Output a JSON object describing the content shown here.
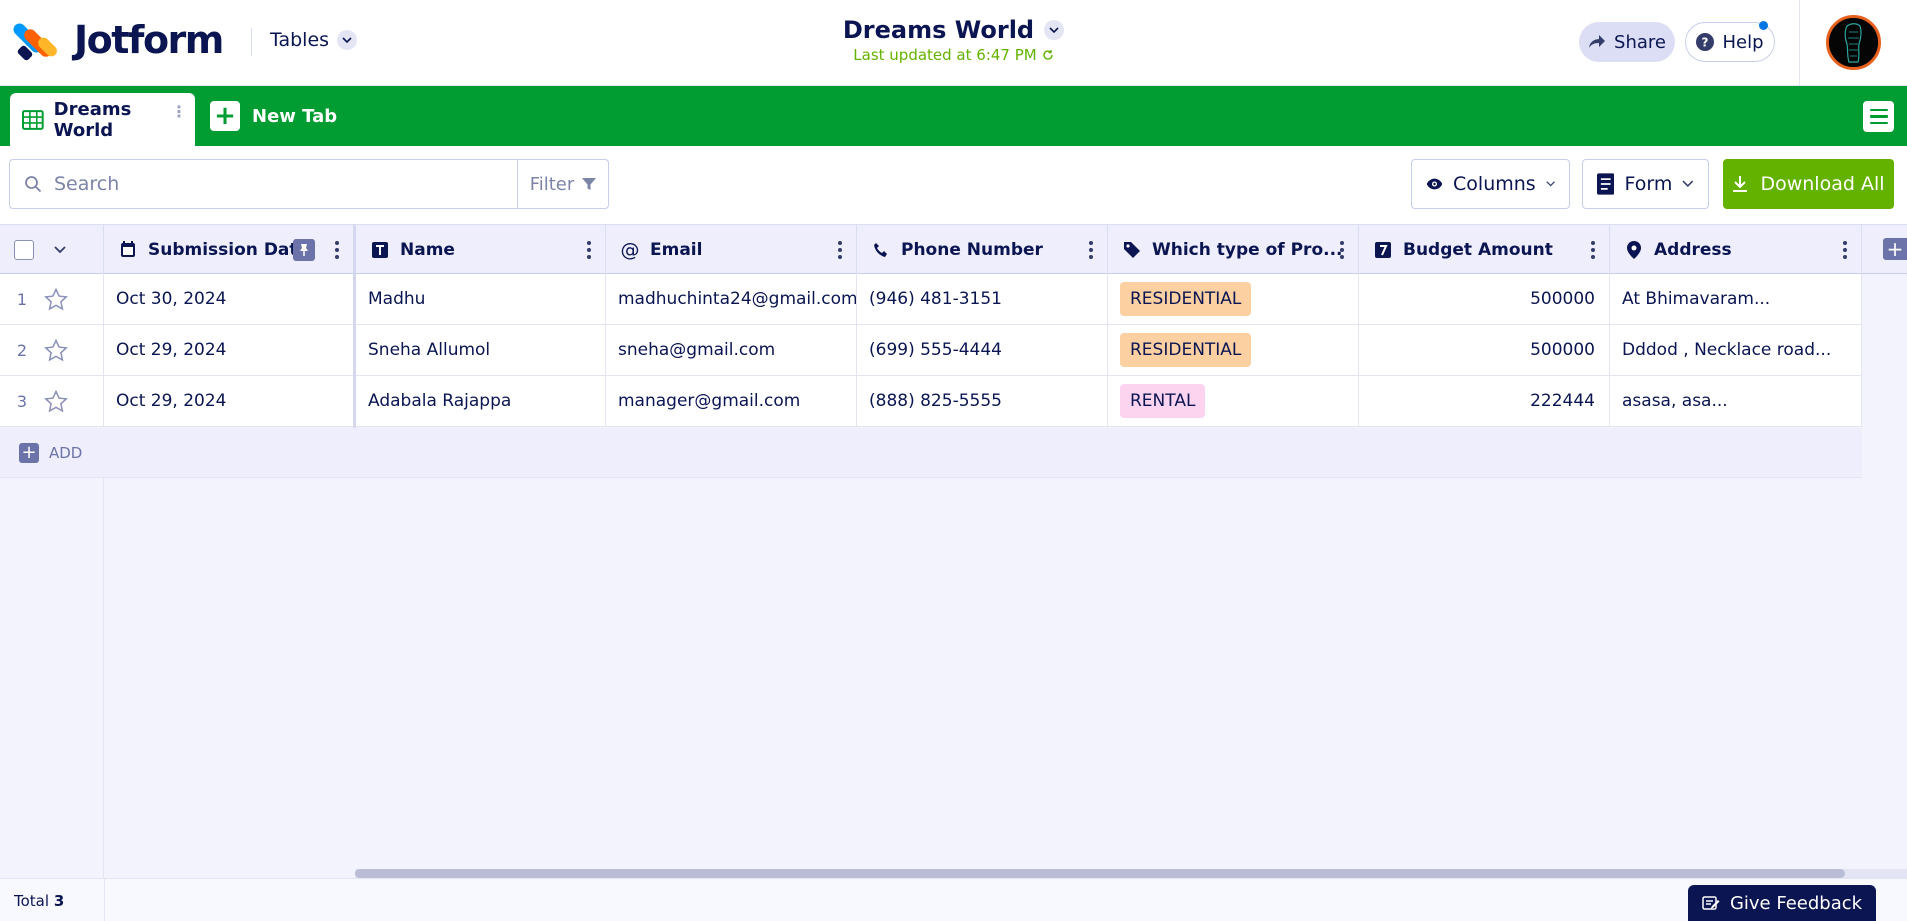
{
  "header": {
    "brand": "Jotform",
    "app_switcher_label": "Tables",
    "title": "Dreams World",
    "last_updated": "Last updated at 6:47 PM",
    "share_label": "Share",
    "help_label": "Help"
  },
  "tabs": {
    "active_tab_label": "Dreams World",
    "new_tab_label": "New Tab"
  },
  "toolbar": {
    "search_placeholder": "Search",
    "filter_label": "Filter",
    "columns_label": "Columns",
    "form_label": "Form",
    "download_label": "Download All"
  },
  "table": {
    "columns": [
      {
        "label": "Submission Date",
        "icon": "calendar-icon"
      },
      {
        "label": "Name",
        "icon": "text-icon"
      },
      {
        "label": "Email",
        "icon": "at-icon"
      },
      {
        "label": "Phone Number",
        "icon": "phone-icon"
      },
      {
        "label": "Which type of Pro...",
        "icon": "tag-icon"
      },
      {
        "label": "Budget Amount",
        "icon": "number-icon"
      },
      {
        "label": "Address",
        "icon": "location-pin-icon"
      }
    ],
    "rows": [
      {
        "n": "1",
        "date": "Oct 30, 2024",
        "name": "Madhu",
        "email": "madhuchinta24@gmail.com",
        "phone": "(946) 481-3151",
        "type": "RESIDENTIAL",
        "budget": "500000",
        "address": "At Bhimavaram..."
      },
      {
        "n": "2",
        "date": "Oct 29, 2024",
        "name": "Sneha Allumol",
        "email": "sneha@gmail.com",
        "phone": "(699) 555-4444",
        "type": "RESIDENTIAL",
        "budget": "500000",
        "address": "Dddod , Necklace road..."
      },
      {
        "n": "3",
        "date": "Oct 29, 2024",
        "name": "Adabala Rajappa",
        "email": "manager@gmail.com",
        "phone": "(888) 825-5555",
        "type": "RENTAL",
        "budget": "222444",
        "address": "asasa, asa..."
      }
    ],
    "add_label": "ADD"
  },
  "footer": {
    "total_label": "Total",
    "total_value": "3",
    "feedback_label": "Give Feedback"
  },
  "colors": {
    "brand_green": "#029d32",
    "download_green": "#64b200",
    "navy": "#0a1551",
    "residential_pill": "#fdd0a2",
    "rental_pill": "#fcd4f0"
  }
}
